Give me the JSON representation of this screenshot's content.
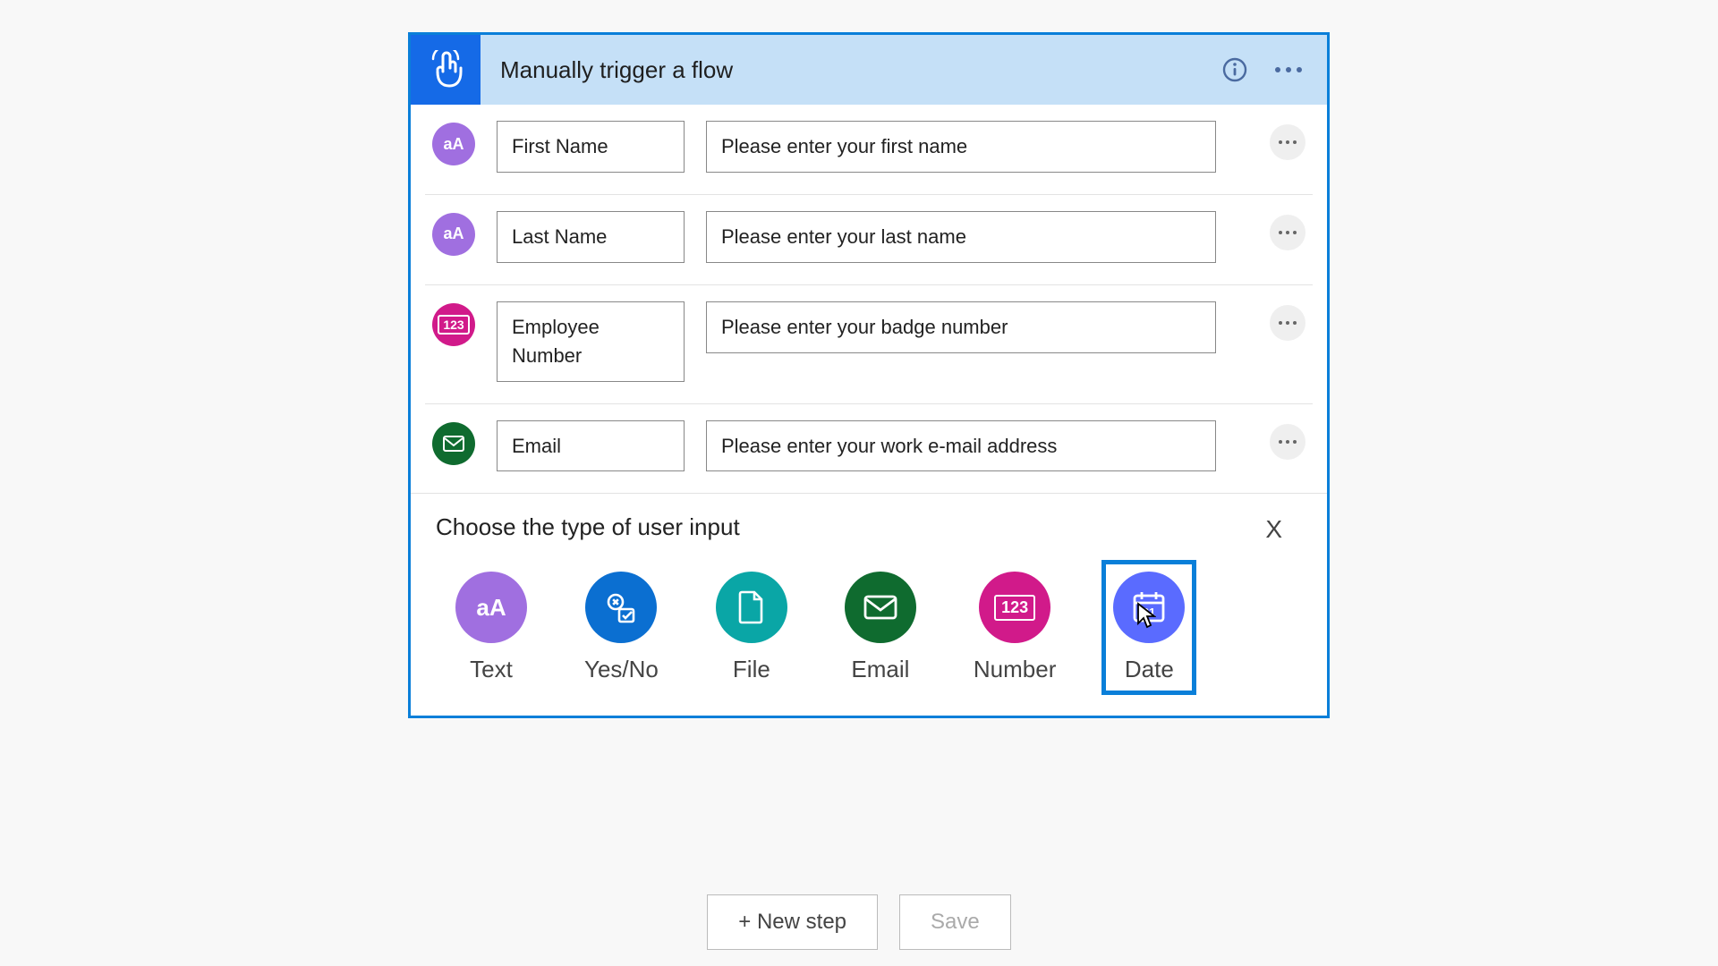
{
  "header": {
    "title": "Manually trigger a flow"
  },
  "inputs": [
    {
      "icon": "text",
      "name": "First Name",
      "placeholder": "Please enter your first name"
    },
    {
      "icon": "text",
      "name": "Last Name",
      "placeholder": "Please enter your last name"
    },
    {
      "icon": "number",
      "name": "Employee Number",
      "placeholder": "Please enter your badge number"
    },
    {
      "icon": "email",
      "name": "Email",
      "placeholder": "Please enter your work e-mail address"
    }
  ],
  "choosePanel": {
    "title": "Choose the type of user input",
    "closeLabel": "X",
    "types": [
      {
        "key": "text",
        "label": "Text"
      },
      {
        "key": "yesno",
        "label": "Yes/No"
      },
      {
        "key": "file",
        "label": "File"
      },
      {
        "key": "email",
        "label": "Email"
      },
      {
        "key": "number",
        "label": "Number"
      },
      {
        "key": "date",
        "label": "Date"
      }
    ],
    "selected": "date"
  },
  "footer": {
    "newStep": "+ New step",
    "save": "Save"
  }
}
